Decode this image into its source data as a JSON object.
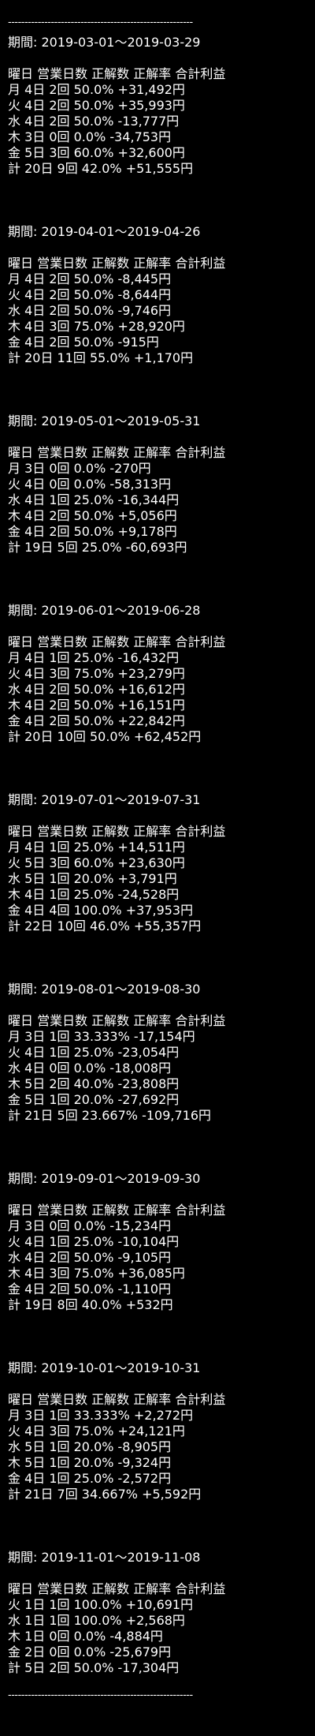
{
  "divider": "--------------------------------------------------------",
  "header": "曜日 営業日数 正解数 正解率 合計利益",
  "sections": [
    {
      "period": "期間: 2019-03-01〜2019-03-29",
      "rows": [
        "月 4日 2回 50.0% +31,492円",
        "火 4日 2回 50.0% +35,993円",
        "水 4日 2回 50.0% -13,777円",
        "木 3日 0回 0.0% -34,753円",
        "金 5日 3回 60.0% +32,600円",
        "計 20日 9回 42.0% +51,555円"
      ]
    },
    {
      "period": "期間: 2019-04-01〜2019-04-26",
      "rows": [
        "月 4日 2回 50.0% -8,445円",
        "火 4日 2回 50.0% -8,644円",
        "水 4日 2回 50.0% -9,746円",
        "木 4日 3回 75.0% +28,920円",
        "金 4日 2回 50.0% -915円",
        "計 20日 11回 55.0% +1,170円"
      ]
    },
    {
      "period": "期間: 2019-05-01〜2019-05-31",
      "rows": [
        "月 3日 0回 0.0% -270円",
        "火 4日 0回 0.0% -58,313円",
        "水 4日 1回 25.0% -16,344円",
        "木 4日 2回 50.0% +5,056円",
        "金 4日 2回 50.0% +9,178円",
        "計 19日 5回 25.0% -60,693円"
      ]
    },
    {
      "period": "期間: 2019-06-01〜2019-06-28",
      "rows": [
        "月 4日 1回 25.0% -16,432円",
        "火 4日 3回 75.0% +23,279円",
        "水 4日 2回 50.0% +16,612円",
        "木 4日 2回 50.0% +16,151円",
        "金 4日 2回 50.0% +22,842円",
        "計 20日 10回 50.0% +62,452円"
      ]
    },
    {
      "period": "期間: 2019-07-01〜2019-07-31",
      "rows": [
        "月 4日 1回 25.0% +14,511円",
        "火 5日 3回 60.0% +23,630円",
        "水 5日 1回 20.0% +3,791円",
        "木 4日 1回 25.0% -24,528円",
        "金 4日 4回 100.0% +37,953円",
        "計 22日 10回 46.0% +55,357円"
      ]
    },
    {
      "period": "期間: 2019-08-01〜2019-08-30",
      "rows": [
        "月 3日 1回 33.333% -17,154円",
        "火 4日 1回 25.0% -23,054円",
        "水 4日 0回 0.0% -18,008円",
        "木 5日 2回 40.0% -23,808円",
        "金 5日 1回 20.0% -27,692円",
        "計 21日 5回 23.667% -109,716円"
      ]
    },
    {
      "period": "期間: 2019-09-01〜2019-09-30",
      "rows": [
        "月 3日 0回 0.0% -15,234円",
        "火 4日 1回 25.0% -10,104円",
        "水 4日 2回 50.0% -9,105円",
        "木 4日 3回 75.0% +36,085円",
        "金 4日 2回 50.0% -1,110円",
        "計 19日 8回 40.0% +532円"
      ]
    },
    {
      "period": "期間: 2019-10-01〜2019-10-31",
      "rows": [
        "月 3日 1回 33.333% +2,272円",
        "火 4日 3回 75.0% +24,121円",
        "水 5日 1回 20.0% -8,905円",
        "木 5日 1回 20.0% -9,324円",
        "金 4日 1回 25.0% -2,572円",
        "計 21日 7回 34.667% +5,592円"
      ]
    },
    {
      "period": "期間: 2019-11-01〜2019-11-08",
      "rows": [
        "火 1日 1回 100.0% +10,691円",
        "水 1日 1回 100.0% +2,568円",
        "木 1日 0回 0.0% -4,884円",
        "金 2日 0回 0.0% -25,679円",
        "計 5日 2回 50.0% -17,304円"
      ]
    }
  ]
}
